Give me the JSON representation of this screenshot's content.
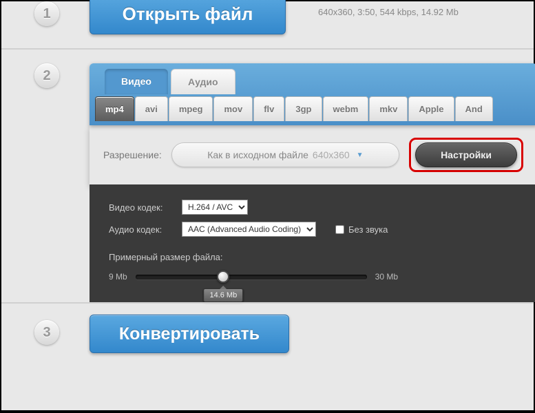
{
  "step1": {
    "number": "1",
    "open_label": "Открыть файл",
    "file_info": "640x360, 3:50, 544 kbps, 14.92 Mb"
  },
  "step2": {
    "number": "2",
    "tabs": {
      "video": "Видео",
      "audio": "Аудио"
    },
    "formats": [
      "mp4",
      "avi",
      "mpeg",
      "mov",
      "flv",
      "3gp",
      "webm",
      "mkv",
      "Apple",
      "And"
    ],
    "resolution_label": "Разрешение:",
    "resolution_text": "Как в исходном файле",
    "resolution_dim": "640x360",
    "settings_label": "Настройки",
    "video_codec_label": "Видео кодек:",
    "video_codec_value": "H.264 / AVC",
    "audio_codec_label": "Аудио кодек:",
    "audio_codec_value": "AAC (Advanced Audio Coding)",
    "no_sound_label": "Без звука",
    "filesize_label": "Примерный размер файла:",
    "size_min": "9 Mb",
    "size_max": "30 Mb",
    "size_current": "14.6 Mb"
  },
  "step3": {
    "number": "3",
    "convert_label": "Конвертировать"
  }
}
